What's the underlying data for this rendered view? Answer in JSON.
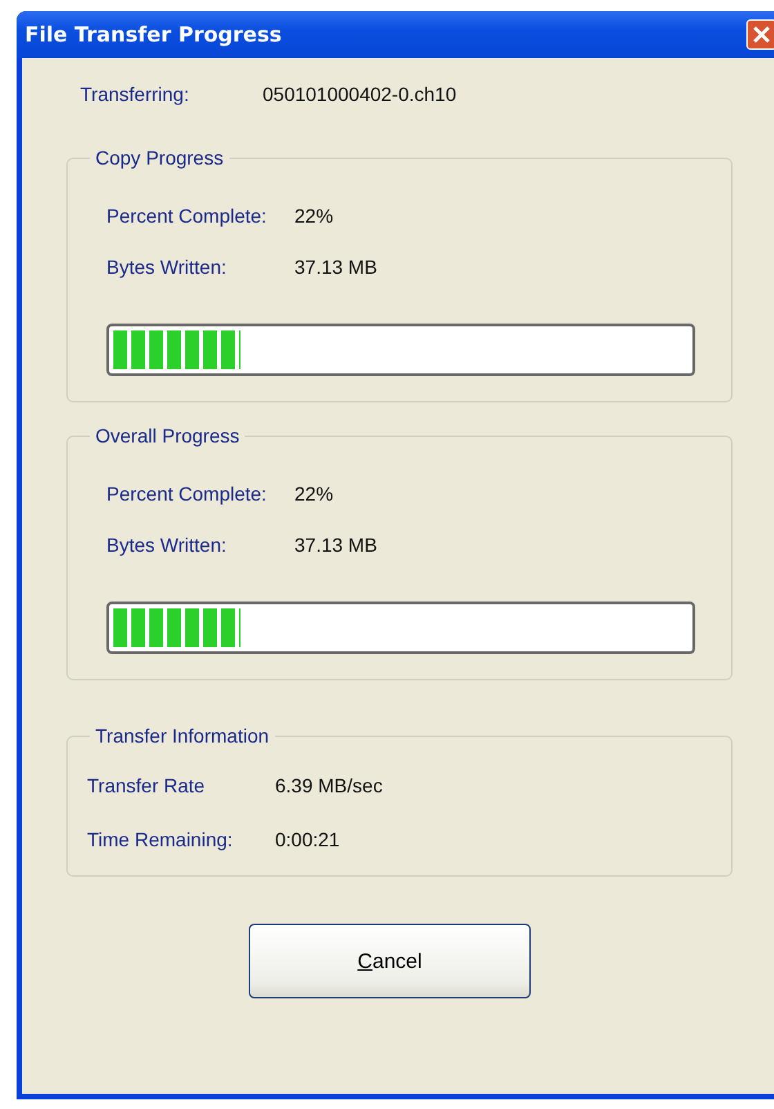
{
  "window": {
    "title": "File Transfer Progress"
  },
  "transferring": {
    "label": "Transferring:",
    "value": "050101000402-0.ch10"
  },
  "groups": [
    {
      "title": "Copy Progress",
      "rows": [
        {
          "label": "Percent Complete:",
          "value": "22%"
        },
        {
          "label": "Bytes Written:",
          "value": "37.13 MB"
        }
      ],
      "progress": {
        "level": 0.22
      }
    },
    {
      "title": "Overall Progress",
      "rows": [
        {
          "label": "Percent Complete:",
          "value": "22%"
        },
        {
          "label": "Bytes Written:",
          "value": "37.13 MB"
        }
      ],
      "progress": {
        "level": 0.22
      }
    },
    {
      "title": "Transfer Information",
      "rows": [
        {
          "label": "Transfer Rate",
          "value": "6.39 MB/sec"
        },
        {
          "label": "Time Remaining:",
          "value": "0:00:21"
        }
      ]
    }
  ],
  "button": {
    "label": "Cancel",
    "underline_first": true
  }
}
